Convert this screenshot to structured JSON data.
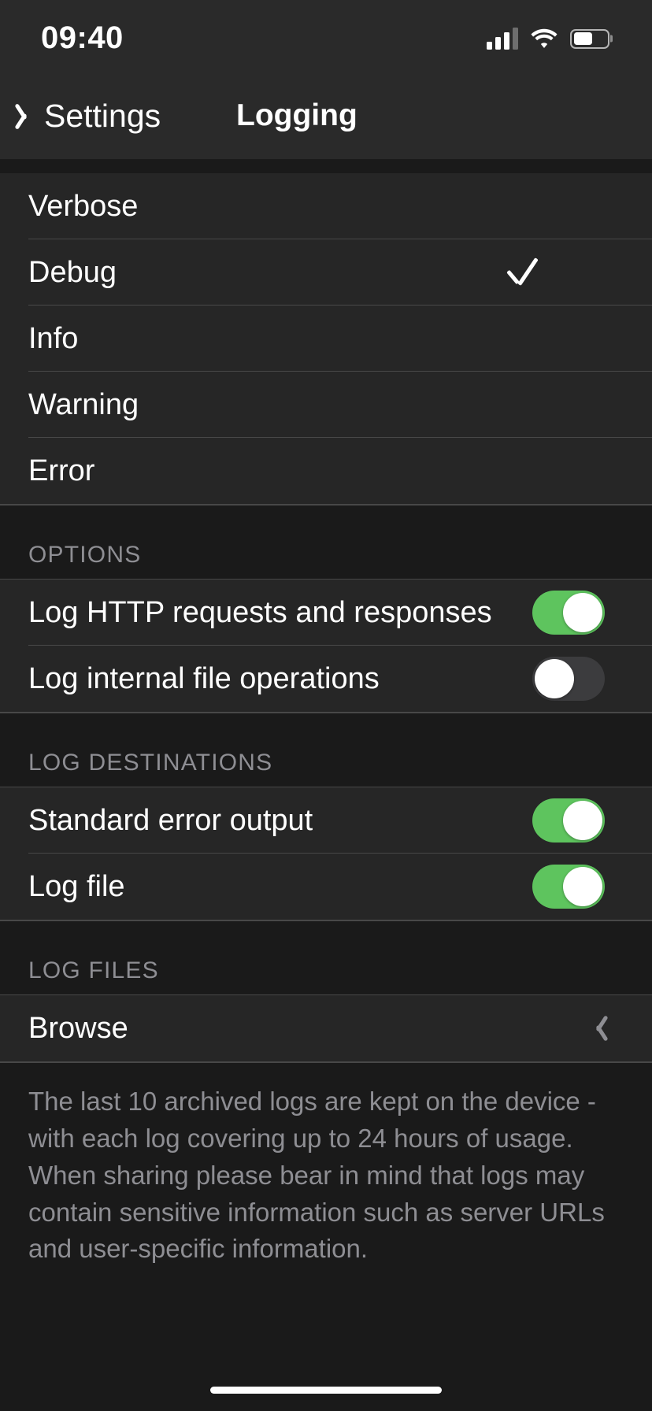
{
  "status_bar": {
    "time": "09:40",
    "signal_icon": "cellular-signal-icon",
    "signal_bars_total": 4,
    "signal_bars_active": 3,
    "wifi_icon": "wifi-icon",
    "battery_icon": "battery-icon",
    "battery_level_percent": 58
  },
  "nav": {
    "back_label": "Settings",
    "back_icon": "chevron-left-icon",
    "title": "Logging"
  },
  "log_levels": {
    "items": [
      {
        "label": "Verbose",
        "selected": false
      },
      {
        "label": "Debug",
        "selected": true
      },
      {
        "label": "Info",
        "selected": false
      },
      {
        "label": "Warning",
        "selected": false
      },
      {
        "label": "Error",
        "selected": false
      }
    ],
    "checkmark_icon": "checkmark-icon"
  },
  "options": {
    "header": "OPTIONS",
    "items": [
      {
        "label": "Log HTTP requests and responses",
        "state": "on"
      },
      {
        "label": "Log internal file operations",
        "state": "off"
      }
    ]
  },
  "log_destinations": {
    "header": "LOG DESTINATIONS",
    "items": [
      {
        "label": "Standard error output",
        "state": "on"
      },
      {
        "label": "Log file",
        "state": "on"
      }
    ]
  },
  "log_files": {
    "header": "LOG FILES",
    "browse_label": "Browse",
    "disclosure_icon": "chevron-right-icon",
    "footer_text": "The last 10 archived logs are kept on the device - with each log covering up to 24 hours of usage. When sharing please bear in mind that logs may contain sensitive information such as server URLs and user-specific information."
  },
  "colors": {
    "background": "#1a1a1a",
    "row_background": "#262626",
    "bar_background": "#2a2a2a",
    "separator": "#484848",
    "text_primary": "#ffffff",
    "text_secondary": "#8e8e93",
    "toggle_on": "#5ec45e",
    "toggle_off": "#3c3c3e",
    "knob": "#ffffff"
  }
}
